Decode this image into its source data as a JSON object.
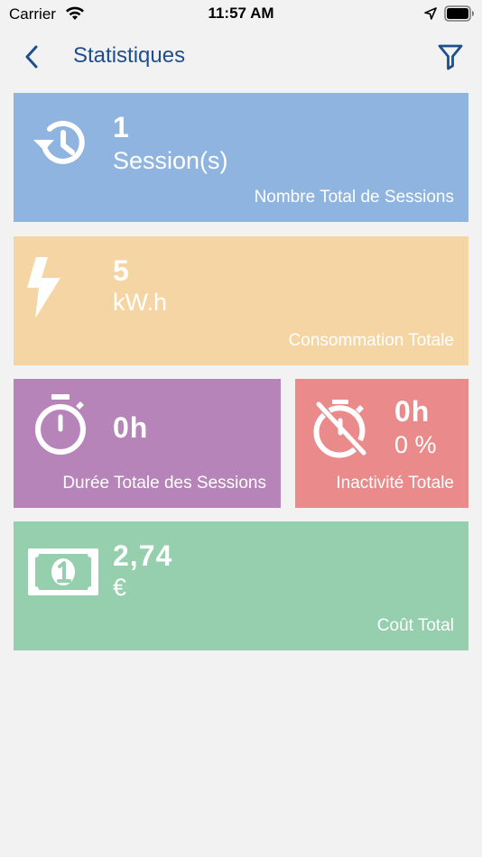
{
  "status_bar": {
    "carrier": "Carrier",
    "time": "11:57 AM"
  },
  "nav": {
    "title": "Statistiques"
  },
  "colors": {
    "sessions": "#8fb4df",
    "consumption": "#f5d5a4",
    "duration": "#b784b9",
    "inactivity": "#ea8a8a",
    "cost": "#95cfad",
    "nav_accent": "#1f4e8c"
  },
  "cards": {
    "sessions": {
      "icon": "history-clock-icon",
      "value": "1",
      "unit": "Session(s)",
      "label": "Nombre Total de Sessions"
    },
    "consumption": {
      "icon": "lightning-bolt-icon",
      "value": "5",
      "unit": "kW.h",
      "label": "Consommation Totale"
    },
    "duration": {
      "icon": "stopwatch-icon",
      "value": "0h",
      "label": "Durée Totale des Sessions"
    },
    "inactivity": {
      "icon": "stopwatch-off-icon",
      "value": "0h",
      "percent": "0 %",
      "label": "Inactivité Totale"
    },
    "cost": {
      "icon": "banknote-icon",
      "value": "2,74",
      "unit": "€",
      "label": "Coût Total"
    }
  }
}
